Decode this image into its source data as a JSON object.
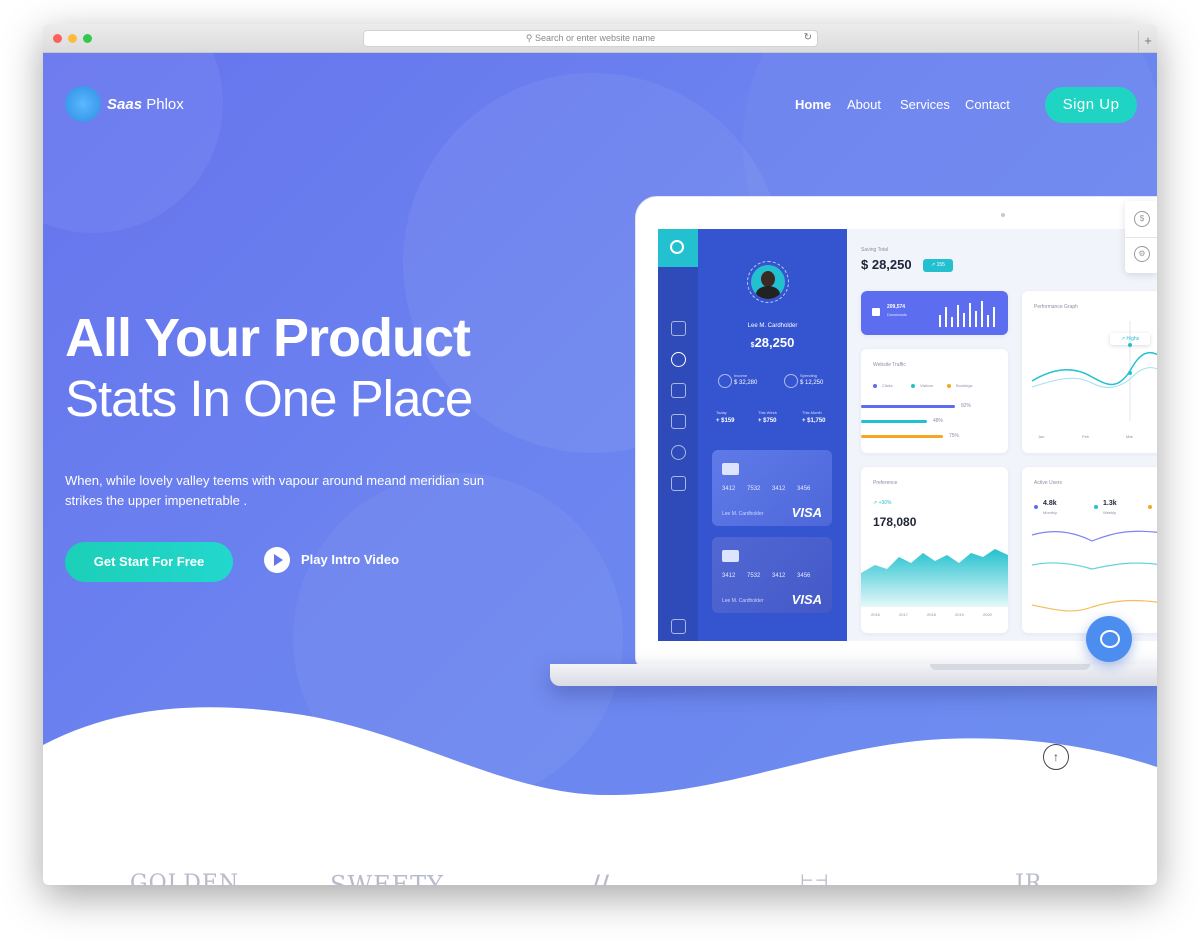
{
  "browser": {
    "url_placeholder": "Search or enter website name",
    "new_tab_symbol": "+"
  },
  "logo": {
    "bold": "Saas",
    "light": "Phlox"
  },
  "nav": {
    "items": [
      "Home",
      "About",
      "Services",
      "Contact"
    ],
    "active": "Home",
    "signup_label": "Sign Up"
  },
  "hero": {
    "title_line1": "All Your Product",
    "title_line2": "Stats In One Place",
    "subtitle": "When, while lovely valley teems with vapour around meand meridian sun strikes the upper impenetrable .",
    "cta_label": "Get Start For Free",
    "play_label": "Play Intro Video"
  },
  "dashboard": {
    "user_name": "Lee M. Cardholder",
    "balance": "28,250",
    "balance_currency": "$",
    "income_label": "Income",
    "income_value": "$ 32,280",
    "spending_label": "Spending",
    "spending_value": "$ 12,250",
    "stats": [
      {
        "label": "Today",
        "value": "+ $159"
      },
      {
        "label": "This Week",
        "value": "+ $750"
      },
      {
        "label": "This Month",
        "value": "+ $1,750"
      }
    ],
    "cards": [
      {
        "number": "3412 7532 3412 3456",
        "holder": "Lee M. Cardholder",
        "brand": "VISA"
      },
      {
        "number": "3412 7532 3412 3456",
        "holder": "Lee M. Cardholder",
        "brand": "VISA"
      }
    ],
    "saving_label": "Saving Total",
    "saving_value": "$ 28,250",
    "saving_badge": "↗ 155",
    "downloads_value": "209,574",
    "downloads_label": "Downloads",
    "performance_title": "Performance Graph",
    "performance_tooltip": "↗ Highs",
    "performance_ticks": [
      "Jan",
      "Feb",
      "Mar"
    ],
    "traffic_title": "Website Traffic",
    "traffic_legend": [
      "Clicks",
      "Visitors",
      "Bookings"
    ],
    "traffic_values": [
      "82%",
      "48%",
      "75%"
    ],
    "earnings_title": "Preference",
    "earnings_trend": "↗ +30%",
    "earnings_value": "178,080",
    "earnings_ticks": [
      "2016",
      "2017",
      "2018",
      "2019",
      "2020"
    ],
    "active_title": "Active Users",
    "active_stats": [
      {
        "value": "4.8k",
        "label": "Monthly"
      },
      {
        "value": "1.3k",
        "label": "Weekly"
      }
    ]
  },
  "brands": [
    "GOLDEN",
    "SWEETY",
    "//",
    "⊢⊣",
    "JR"
  ],
  "colors": {
    "accent": "#1fd4c2",
    "hero_start": "#6674ee",
    "hero_end": "#6e8ff0",
    "sidebar": "#3554cf",
    "chat": "#4c8ef0"
  }
}
